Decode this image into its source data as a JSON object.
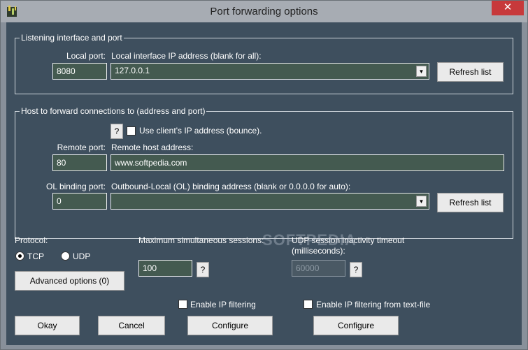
{
  "window": {
    "title": "Port forwarding options",
    "close_symbol": "✕"
  },
  "listening": {
    "group_title": "Listening interface and port",
    "local_port_label": "Local port:",
    "local_port_value": "8080",
    "ip_label": "Local interface IP address (blank for all):",
    "ip_value": "127.0.0.1",
    "refresh_label": "Refresh list"
  },
  "forward": {
    "group_title": "Host to forward connections to (address and port)",
    "help_label": "?",
    "bounce_label": "Use client's IP address (bounce).",
    "remote_port_label": "Remote port:",
    "remote_port_value": "80",
    "remote_host_label": "Remote host address:",
    "remote_host_value": "www.softpedia.com",
    "ol_port_label": "OL binding port:",
    "ol_port_value": "0",
    "ol_address_label": "Outbound-Local (OL) binding address (blank or 0.0.0.0 for auto):",
    "ol_address_value": "",
    "refresh_label": "Refresh list"
  },
  "protocol": {
    "label": "Protocol:",
    "tcp_label": "TCP",
    "udp_label": "UDP",
    "selected": "TCP"
  },
  "advanced_button": "Advanced options (0)",
  "sessions": {
    "label": "Maximum simultaneous sessions:",
    "value": "100",
    "help_label": "?"
  },
  "udp_timeout": {
    "label_line1": "UDP session inactivity timeout",
    "label_line2": "(milliseconds):",
    "value": "60000",
    "help_label": "?"
  },
  "ip_filter": {
    "label": "Enable IP filtering",
    "configure_label": "Configure"
  },
  "ip_filter_file": {
    "label": "Enable IP filtering from text-file",
    "configure_label": "Configure"
  },
  "footer": {
    "okay_label": "Okay",
    "cancel_label": "Cancel"
  },
  "watermark": "SOFTPEDIA",
  "colors": {
    "client_bg": "#3e4f5e",
    "field_bg": "#445a50",
    "titlebar_bg": "#a7acb3",
    "close_bg": "#c7393b"
  },
  "icons": {
    "app": "app-icon",
    "close": "close-icon",
    "dropdown": "chevron-down-icon",
    "help": "help-icon"
  }
}
